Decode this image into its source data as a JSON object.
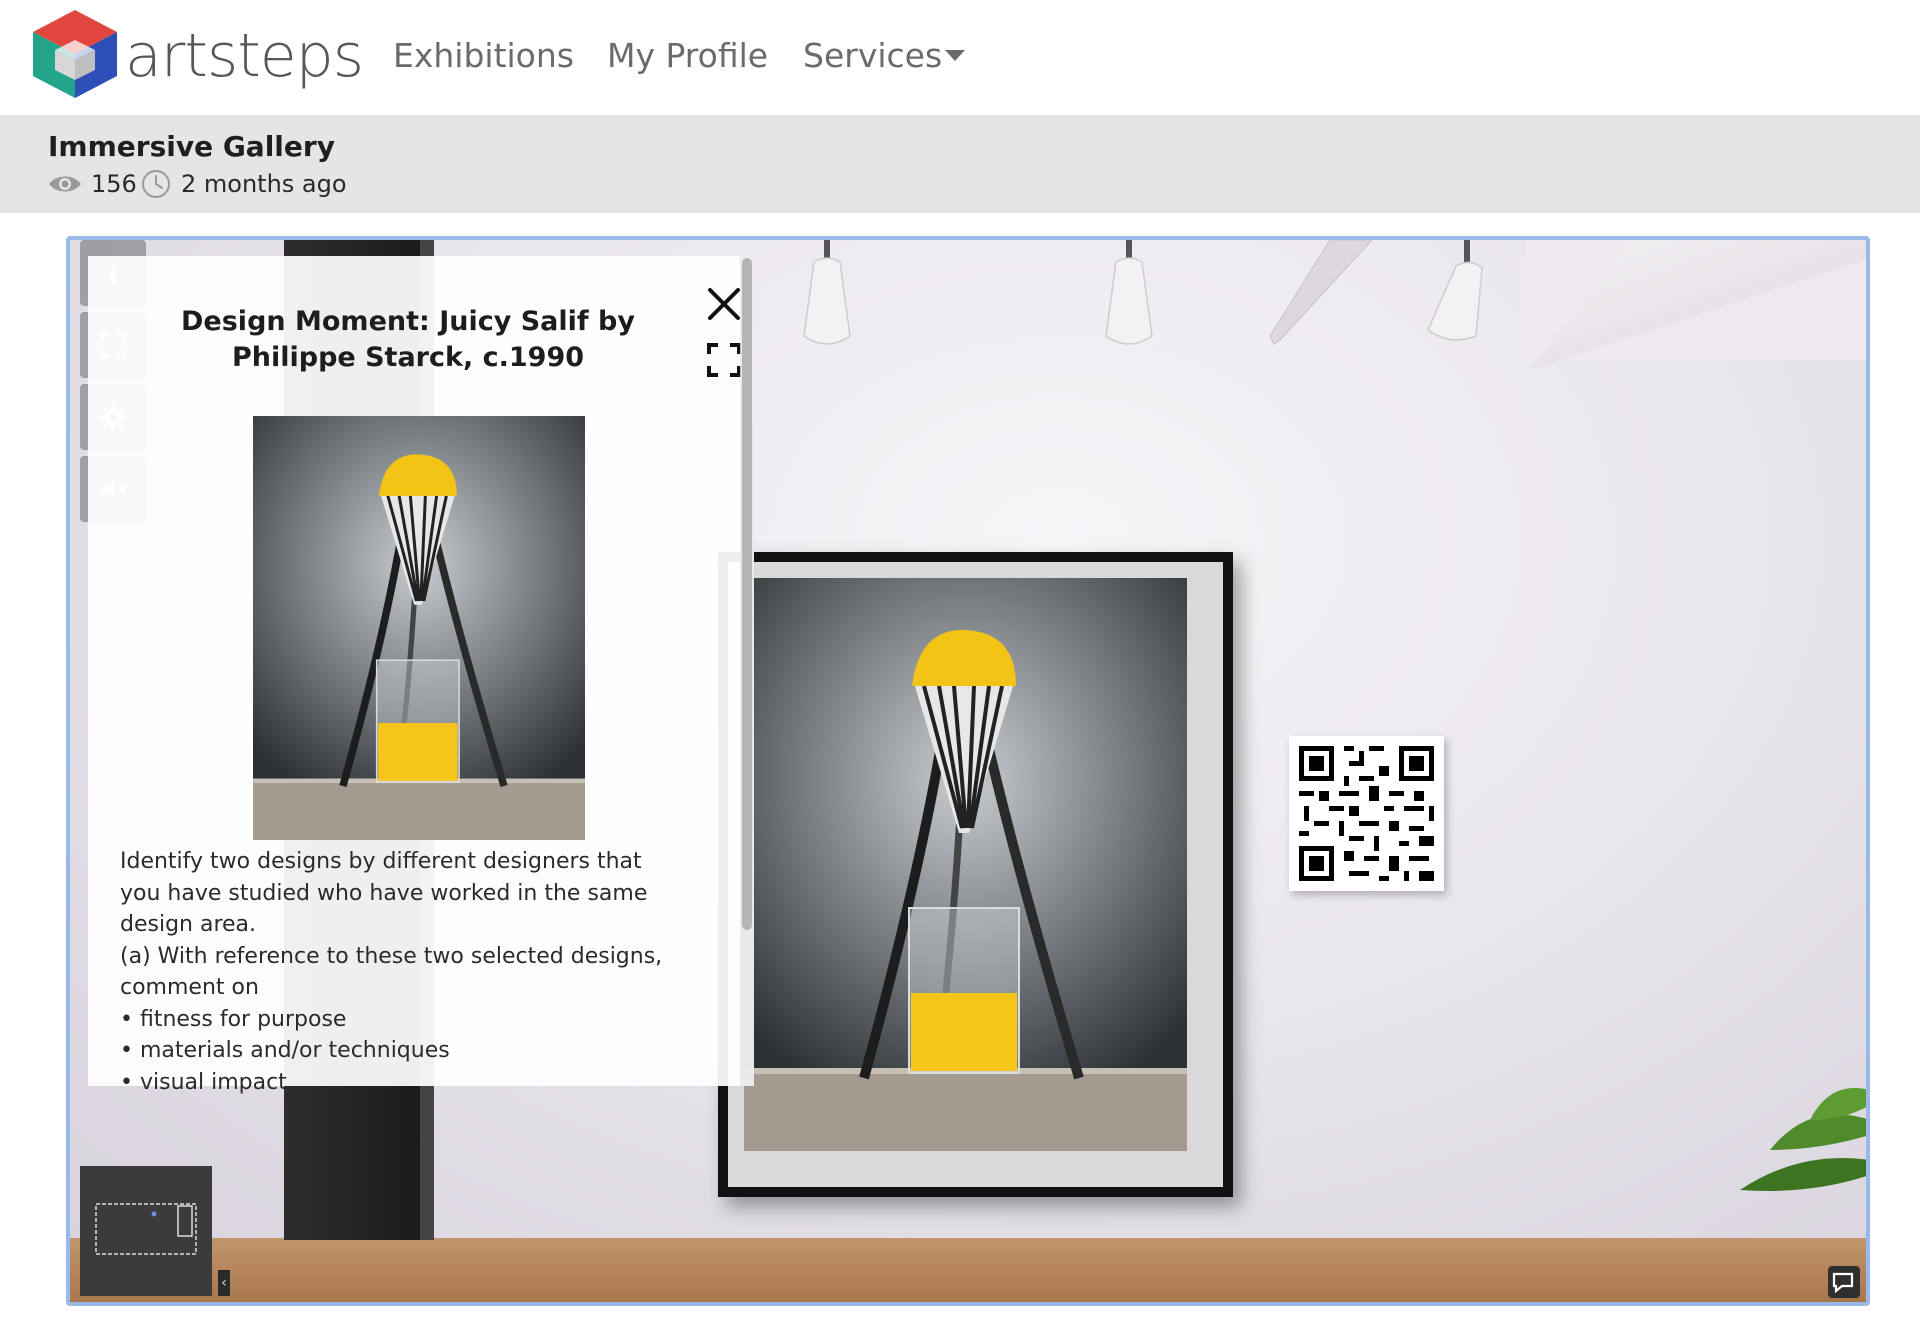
{
  "nav": {
    "brand": "artsteps",
    "links": [
      "Exhibitions",
      "My Profile",
      "Services"
    ]
  },
  "gallery": {
    "title": "Immersive Gallery",
    "views": "156",
    "posted": "2 months ago"
  },
  "panel": {
    "title": "Design Moment: Juicy Salif by Philippe Starck, c.1990",
    "paragraphs": [
      "Identify two designs by different designers that you have studied who have worked in the same design area.",
      "(a) With reference to these two selected designs, comment on",
      "• fitness for purpose",
      "• materials and/or techniques",
      "• visual impact."
    ]
  },
  "icons": {
    "logo": "artsteps-cube-logo",
    "views": "eye-icon",
    "time": "clock-icon",
    "close": "close-icon",
    "expand": "expand-icon",
    "info": "info-icon",
    "fullscreen": "fullscreen-icon",
    "settings": "gear-icon",
    "mute": "mute-icon",
    "chat": "chat-icon",
    "minimap_toggle": "chevron-left-icon"
  },
  "colors": {
    "viewer_border": "#9ab8e8",
    "titlebar_bg": "#e5e5e5",
    "juice": "#f2c21b"
  }
}
